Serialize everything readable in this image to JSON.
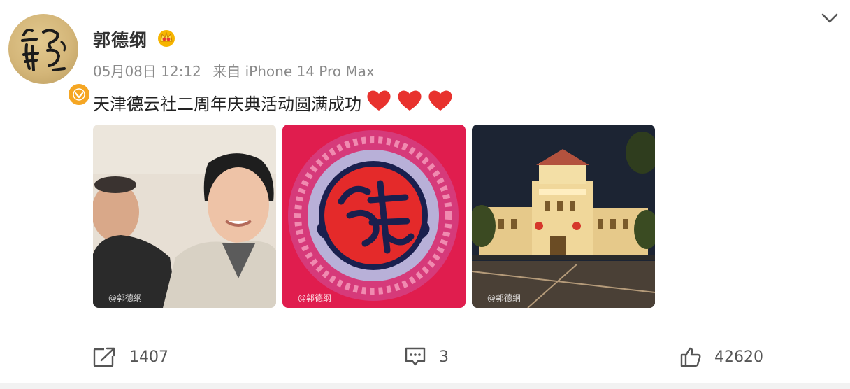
{
  "post": {
    "author": "郭德纲",
    "date": "05月08日 12:12",
    "source": "来自 iPhone 14 Pro Max",
    "text": "天津德云社二周年庆典活动圆满成功",
    "hearts": 3
  },
  "photos": [
    {
      "watermark": "@郭德纲"
    },
    {
      "watermark": "@郭德纲"
    },
    {
      "watermark": "@郭德纲"
    }
  ],
  "actions": {
    "repost_count": "1407",
    "comment_count": "3",
    "like_count": "42620"
  },
  "colors": {
    "accent": "#f5a623",
    "heart": "#e8322e",
    "text_secondary": "#8a8a8a"
  },
  "icons": {
    "menu": "chevron-down-icon",
    "badge": "verified-icon",
    "crown": "crown-icon",
    "repost": "share-icon",
    "comment": "comment-icon",
    "like": "thumbs-up-icon"
  }
}
